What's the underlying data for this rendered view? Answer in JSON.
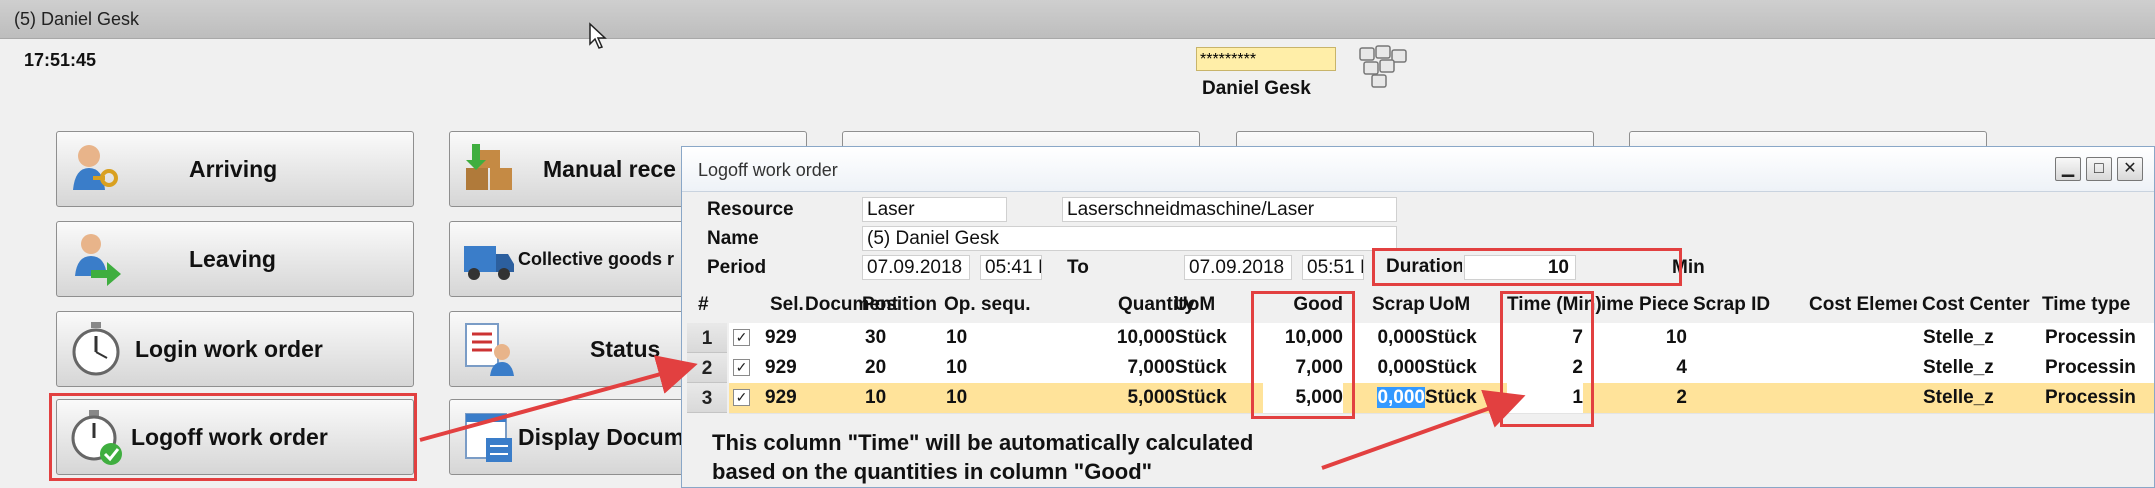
{
  "window": {
    "title": "(5) Daniel  Gesk"
  },
  "clock": "17:51:45",
  "user": {
    "password_mask": "*********",
    "name": "Daniel  Gesk"
  },
  "menu": {
    "arriving": "Arriving",
    "leaving": "Leaving",
    "login_wo": "Login work order",
    "logoff_wo": "Logoff work order",
    "manual": "Manual rece",
    "collective": "Collective goods r",
    "status": "Status",
    "display": "Display Docum"
  },
  "dialog": {
    "title": "Logoff work order",
    "resource_label": "Resource",
    "resource_value": "Laser",
    "resource_desc": "Laserschneidmaschine/Laser",
    "name_label": "Name",
    "name_value": "(5) Daniel Gesk",
    "period_label": "Period",
    "from_date": "07.09.2018",
    "from_time": "05:41 I",
    "to_label": "To",
    "to_date": "07.09.2018",
    "to_time": "05:51 I",
    "duration_label": "Duration",
    "duration_value": "10",
    "duration_unit": "Min",
    "window_buttons": {
      "minimize": "▁",
      "maximize": "□",
      "close": "✕"
    }
  },
  "table": {
    "headers": {
      "num": "#",
      "sel": "Sel.",
      "doc": "Document",
      "pos": "Position",
      "op": "Op. sequ.",
      "qty": "Quantity",
      "uom": "UoM",
      "good": "Good",
      "scrap": "Scrap",
      "uom2": "UoM",
      "time": "Time (Min)",
      "piece": "ime Piece",
      "scrapid": "Scrap ID",
      "costel": "Cost Elemen",
      "costc": "Cost Center",
      "ttype": "Time type"
    },
    "rows": [
      {
        "n": "1",
        "check": "✓",
        "doc": "929",
        "pos": "30",
        "op": "10",
        "qty": "10,000",
        "uom": "Stück",
        "good": "10,000",
        "scrap": "0,000",
        "uom2": "Stück",
        "time": "7",
        "piece": "10",
        "costc": "Stelle_z",
        "ttype": "Processin"
      },
      {
        "n": "2",
        "check": "✓",
        "doc": "929",
        "pos": "20",
        "op": "10",
        "qty": "7,000",
        "uom": "Stück",
        "good": "7,000",
        "scrap": "0,000",
        "uom2": "Stück",
        "time": "2",
        "piece": "4",
        "costc": "Stelle_z",
        "ttype": "Processin"
      },
      {
        "n": "3",
        "check": "✓",
        "doc": "929",
        "pos": "10",
        "op": "10",
        "qty": "5,000",
        "uom": "Stück",
        "good": "5,000",
        "scrap": "0,000",
        "uom2": "Stück",
        "time": "1",
        "piece": "2",
        "costc": "Stelle_z",
        "ttype": "Processin"
      }
    ]
  },
  "annotation": {
    "line1": "This column \"Time\" will be automatically calculated",
    "line2": "based on the quantities in column \"Good\""
  },
  "colors": {
    "highlight_row": "#ffe39a",
    "annotation_red": "#e24040",
    "password_bg": "#ffeea8"
  }
}
